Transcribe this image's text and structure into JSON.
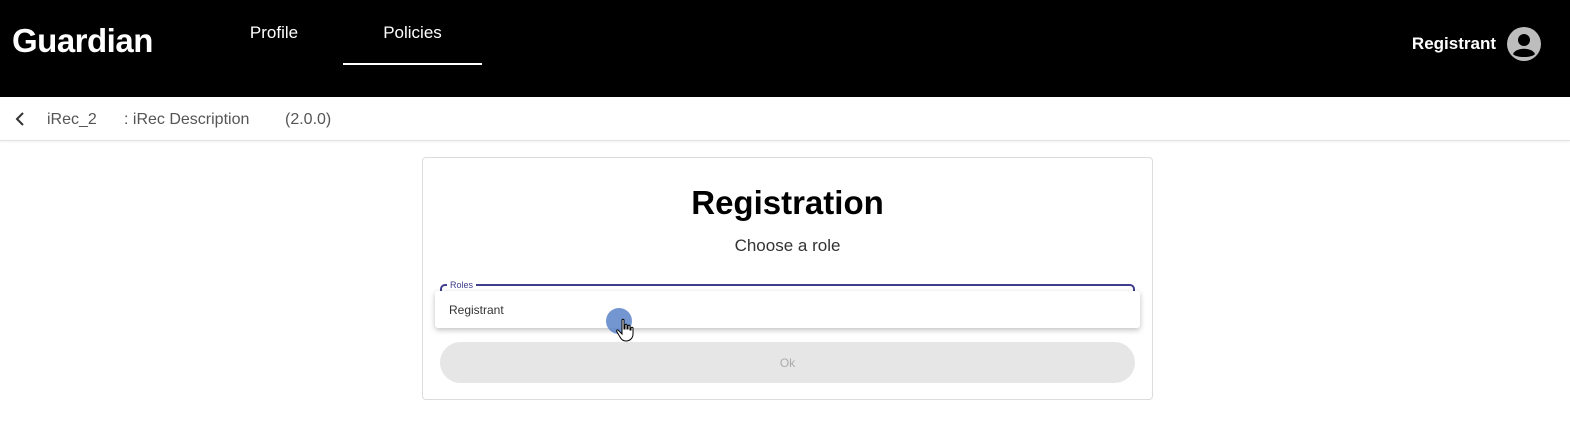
{
  "header": {
    "logo": "Guardian",
    "tabs": [
      {
        "label": "Profile",
        "active": false
      },
      {
        "label": "Policies",
        "active": true
      }
    ],
    "user_name": "Registrant",
    "avatar_icon": "account-circle-icon"
  },
  "breadcrumb": {
    "back_icon": "chevron-left-icon",
    "policy_name": "iRec_2",
    "policy_description": ": iRec Description",
    "policy_version": "(2.0.0)"
  },
  "registration": {
    "title": "Registration",
    "subtitle": "Choose a role",
    "roles_label": "Roles",
    "options": [
      "Registrant"
    ],
    "ok_label": "Ok"
  },
  "colors": {
    "header_bg": "#000000",
    "accent": "#3f3d8c",
    "disabled_button": "#e6e6e6"
  }
}
